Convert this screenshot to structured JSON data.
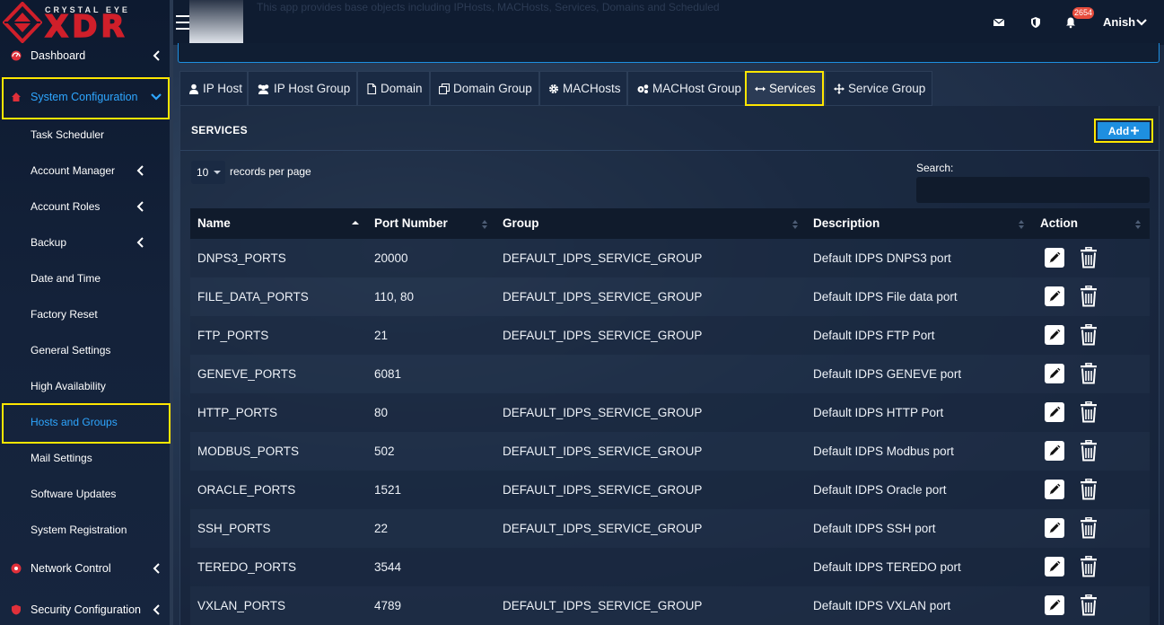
{
  "brand": {
    "top": "CRYSTAL EYE",
    "main": "XDR"
  },
  "topbar": {
    "app_description": "This app provides base objects including IPHosts, MACHosts, Services, Domains and Scheduled",
    "notification_count": "2654",
    "user_name": "Anish"
  },
  "sidebar": {
    "items": [
      {
        "label": "Dashboard"
      },
      {
        "label": "System Configuration"
      },
      {
        "label": "Task Scheduler"
      },
      {
        "label": "Account Manager"
      },
      {
        "label": "Account Roles"
      },
      {
        "label": "Backup"
      },
      {
        "label": "Date and Time"
      },
      {
        "label": "Factory Reset"
      },
      {
        "label": "General Settings"
      },
      {
        "label": "High Availability"
      },
      {
        "label": "Hosts and Groups"
      },
      {
        "label": "Mail Settings"
      },
      {
        "label": "Software Updates"
      },
      {
        "label": "System Registration"
      },
      {
        "label": "Network Control"
      },
      {
        "label": "Security Configuration"
      }
    ]
  },
  "tabs": [
    {
      "label": "IP Host",
      "icon": "user-icon"
    },
    {
      "label": "IP Host Group",
      "icon": "users-icon"
    },
    {
      "label": "Domain",
      "icon": "document-icon"
    },
    {
      "label": "Domain Group",
      "icon": "copy-icon"
    },
    {
      "label": "MACHosts",
      "icon": "gear-icon"
    },
    {
      "label": "MACHost Group",
      "icon": "gears-icon"
    },
    {
      "label": "Services",
      "icon": "arrows-h-icon"
    },
    {
      "label": "Service Group",
      "icon": "arrows-move-icon"
    }
  ],
  "panel": {
    "title": "SERVICES",
    "add_label": "Add"
  },
  "table_controls": {
    "page_length": "10",
    "records_label": "records per page",
    "search_label": "Search:",
    "search_value": ""
  },
  "table": {
    "columns": [
      "Name",
      "Port Number",
      "Group",
      "Description",
      "Action"
    ],
    "rows": [
      {
        "name": "DNPS3_PORTS",
        "port": "20000",
        "group": "DEFAULT_IDPS_SERVICE_GROUP",
        "description": "Default IDPS DNPS3 port"
      },
      {
        "name": "FILE_DATA_PORTS",
        "port": "110, 80",
        "group": "DEFAULT_IDPS_SERVICE_GROUP",
        "description": "Default IDPS File data port"
      },
      {
        "name": "FTP_PORTS",
        "port": "21",
        "group": "DEFAULT_IDPS_SERVICE_GROUP",
        "description": "Default IDPS FTP Port"
      },
      {
        "name": "GENEVE_PORTS",
        "port": "6081",
        "group": "",
        "description": "Default IDPS GENEVE port"
      },
      {
        "name": "HTTP_PORTS",
        "port": "80",
        "group": "DEFAULT_IDPS_SERVICE_GROUP",
        "description": "Default IDPS HTTP Port"
      },
      {
        "name": "MODBUS_PORTS",
        "port": "502",
        "group": "DEFAULT_IDPS_SERVICE_GROUP",
        "description": "Default IDPS Modbus port"
      },
      {
        "name": "ORACLE_PORTS",
        "port": "1521",
        "group": "DEFAULT_IDPS_SERVICE_GROUP",
        "description": "Default IDPS Oracle port"
      },
      {
        "name": "SSH_PORTS",
        "port": "22",
        "group": "DEFAULT_IDPS_SERVICE_GROUP",
        "description": "Default IDPS SSH port"
      },
      {
        "name": "TEREDO_PORTS",
        "port": "3544",
        "group": "",
        "description": "Default IDPS TEREDO port"
      },
      {
        "name": "VXLAN_PORTS",
        "port": "4789",
        "group": "DEFAULT_IDPS_SERVICE_GROUP",
        "description": "Default IDPS VXLAN port"
      }
    ]
  },
  "colors": {
    "accent": "#1e8fe0",
    "highlight": "#ffe600",
    "brand_red": "#d01f2a",
    "active_nav": "#2ea6ff"
  }
}
